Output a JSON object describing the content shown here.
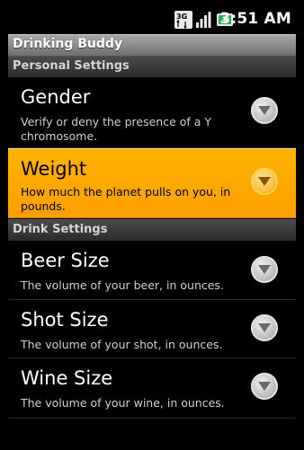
{
  "status_bar": {
    "time": "3:51 AM",
    "icons": [
      "3g-icon",
      "signal-bars-icon",
      "battery-charging-icon"
    ]
  },
  "app": {
    "title": "Drinking Buddy"
  },
  "categories": [
    {
      "title": "Personal Settings"
    },
    {
      "title": "Drink Settings"
    }
  ],
  "prefs": [
    {
      "title": "Gender",
      "summary": "Verify or deny the presence of a Y chromosome.",
      "selected": false
    },
    {
      "title": "Weight",
      "summary": "How much the planet pulls on you, in pounds.",
      "selected": true
    },
    {
      "title": "Beer Size",
      "summary": "The volume of your beer, in ounces.",
      "selected": false
    },
    {
      "title": "Shot Size",
      "summary": "The volume of your shot, in ounces.",
      "selected": false
    },
    {
      "title": "Wine Size",
      "summary": "The volume of your wine, in ounces.",
      "selected": false
    }
  ],
  "colors": {
    "selected_bg": "#ffa800",
    "title_bar": "#8a8a8a",
    "category_bar": "#3a3a3a"
  }
}
